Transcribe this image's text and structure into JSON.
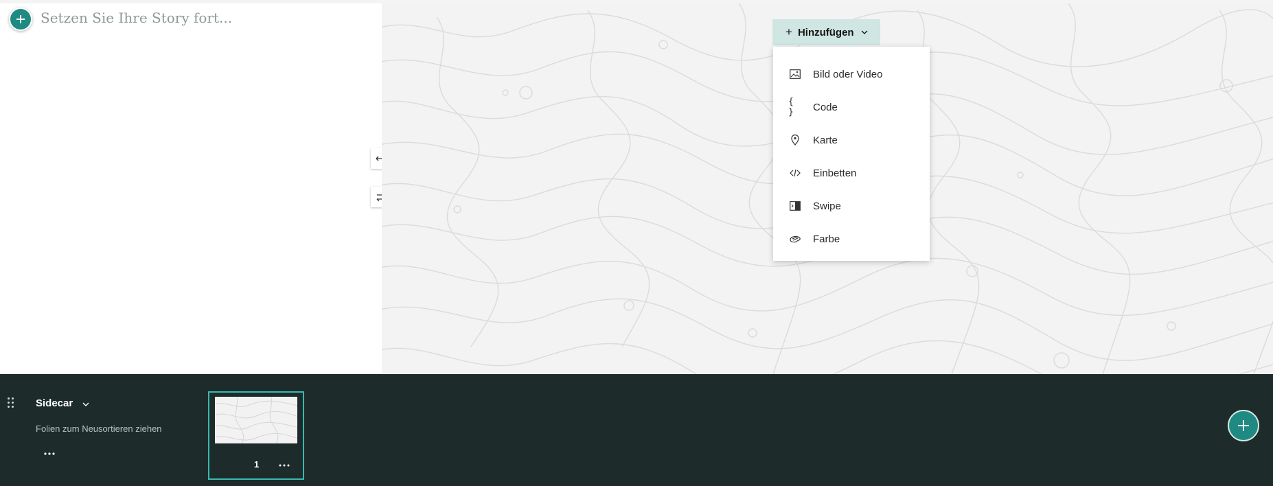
{
  "narrative": {
    "placeholder": "Setzen Sie Ihre Story fort..."
  },
  "side_tools": {
    "expand_icon": "arrows-horizontal-icon",
    "swap_icon": "swap-panels-icon"
  },
  "media": {
    "background": "topographic-pattern",
    "add_button": {
      "label": "Hinzufügen"
    },
    "add_menu": {
      "items": [
        {
          "label": "Bild oder Video",
          "icon": "image-icon"
        },
        {
          "label": "Code",
          "icon": "code-braces-icon"
        },
        {
          "label": "Karte",
          "icon": "map-pin-icon"
        },
        {
          "label": "Einbetten",
          "icon": "embed-icon"
        },
        {
          "label": "Swipe",
          "icon": "swipe-icon"
        },
        {
          "label": "Farbe",
          "icon": "palette-icon"
        }
      ]
    }
  },
  "slides_bar": {
    "layout_name": "Sidecar",
    "hint": "Folien zum Neusortieren ziehen",
    "slides": [
      {
        "number": "1"
      }
    ]
  },
  "colors": {
    "accent": "#1f8a82",
    "bar_background": "#1e2b2b",
    "selection": "#3ab8b0",
    "add_button_bg": "#cfe6e2"
  }
}
